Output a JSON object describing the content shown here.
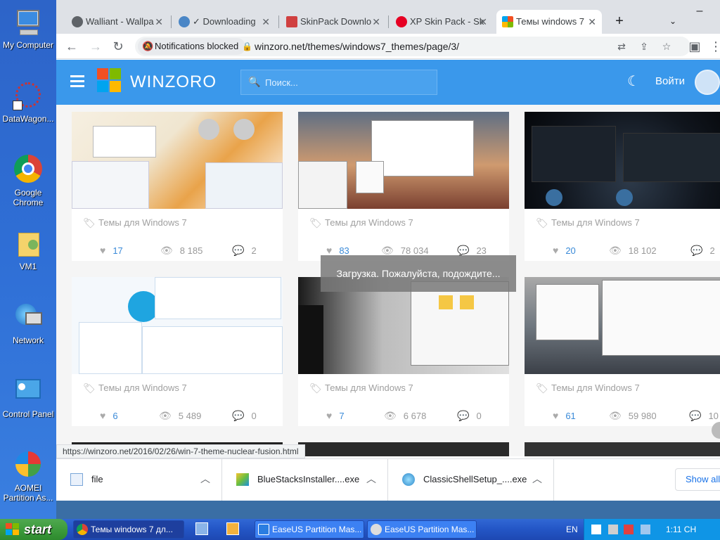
{
  "desktop": {
    "icons": [
      {
        "label": "My Computer",
        "icon": "my-computer-icon"
      },
      {
        "label": "DataWagon...",
        "icon": "datawagon-icon"
      },
      {
        "label": "Google Chrome",
        "icon": "chrome-icon"
      },
      {
        "label": "VM1",
        "icon": "folder-user-icon"
      },
      {
        "label": "Network",
        "icon": "network-icon"
      },
      {
        "label": "Control Panel",
        "icon": "control-panel-icon"
      },
      {
        "label": "AOMEI Partition As...",
        "icon": "aomei-icon"
      }
    ]
  },
  "browser": {
    "tabs": [
      {
        "title": "Walliant - Wallpa",
        "color": "#5f6368"
      },
      {
        "title": "✓ Downloading",
        "color": "#4a86c6"
      },
      {
        "title": "SkinPack Downlo",
        "color": "#d04040"
      },
      {
        "title": "XP Skin Pack - Sk",
        "color": "#e60023"
      },
      {
        "title": "Темы windows 7",
        "color": "#f25022"
      }
    ],
    "new_tab": "+",
    "notifications_blocked": "Notifications blocked",
    "url": "winzoro.net/themes/windows7_themes/page/3/",
    "status_url": "https://winzoro.net/2016/02/26/win-7-theme-nuclear-fusion.html"
  },
  "site": {
    "brand": "WINZORO",
    "search_placeholder": "Поиск...",
    "login": "Войти"
  },
  "cards": [
    {
      "tag": "Темы для Windows 7",
      "likes": "17",
      "views": "8 185",
      "comments": "2"
    },
    {
      "tag": "Темы для Windows 7",
      "likes": "83",
      "views": "78 034",
      "comments": "23"
    },
    {
      "tag": "Темы для Windows 7",
      "likes": "20",
      "views": "18 102",
      "comments": "2"
    },
    {
      "tag": "Темы для Windows 7",
      "likes": "6",
      "views": "5 489",
      "comments": "0"
    },
    {
      "tag": "Темы для Windows 7",
      "likes": "7",
      "views": "6 678",
      "comments": "0"
    },
    {
      "tag": "Темы для Windows 7",
      "likes": "61",
      "views": "59 980",
      "comments": "10"
    }
  ],
  "loading_text": "Загрузка. Пожалуйста, подождите...",
  "downloads": [
    {
      "name": "file"
    },
    {
      "name": "BlueStacksInstaller....exe"
    },
    {
      "name": "ClassicShellSetup_....exe"
    }
  ],
  "show_all": "Show all",
  "taskbar": {
    "start": "start",
    "tasks": [
      {
        "label": "Темы windows 7 дл...",
        "active": true
      },
      {
        "label": "EaseUS Partition Mas...",
        "active": false
      },
      {
        "label": "EaseUS Partition Mas...",
        "active": false
      }
    ],
    "lang": "EN",
    "clock": "1:11 CH"
  }
}
